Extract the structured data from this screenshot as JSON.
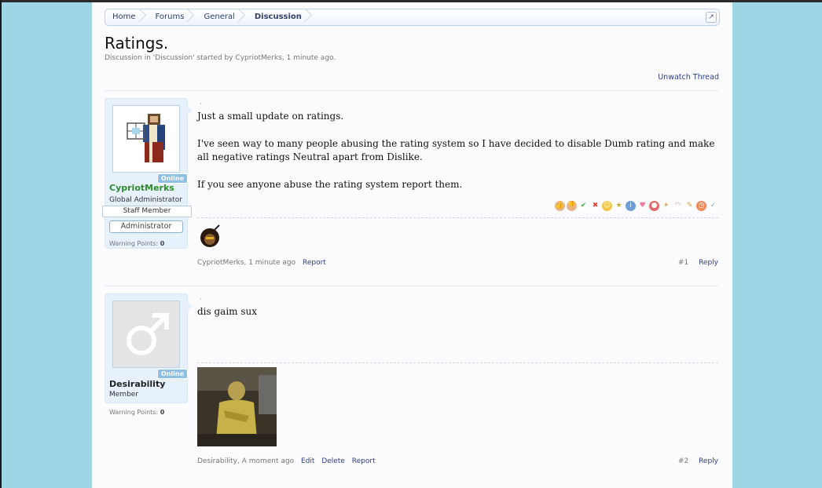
{
  "breadcrumb": {
    "items": [
      "Home",
      "Forums",
      "General",
      "Discussion"
    ],
    "jump_icon": "external-link-icon"
  },
  "thread": {
    "title": "Ratings.",
    "description": "Discussion in 'Discussion' started by CypriotMerks, 1 minute ago.",
    "unwatch_label": "Unwatch Thread"
  },
  "posts": [
    {
      "username": "CypriotMerks",
      "username_color": "#2e8b2e",
      "user_title": "Global Administrator",
      "banner": "Staff Member",
      "role_button": "Administrator",
      "online_badge": "Online",
      "warning_label": "Warning Points:",
      "warning_value": "0",
      "paragraphs": [
        "Just a small update on ratings.",
        "I've seen way to many people abusing the rating system so I have decided to disable Dumb rating and make all negative ratings Neutral apart from Dislike.",
        "If you see anyone abuse the rating system report them."
      ],
      "meta_author": "CypriotMerks",
      "meta_time": "1 minute ago",
      "actions": [
        "Report"
      ],
      "post_number": "#1",
      "reply_label": "Reply",
      "rating_icons": [
        "like-icon",
        "dislike-icon",
        "agree-icon",
        "disagree-icon",
        "funny-icon",
        "winner-icon",
        "informative-icon",
        "friendly-icon",
        "useful-icon",
        "optimistic-icon",
        "creative-icon",
        "coherent-icon",
        "late-icon",
        "programming-icon"
      ]
    },
    {
      "username": "Desirability",
      "username_color": "#222222",
      "user_title": "Member",
      "online_badge": "Online",
      "warning_label": "Warning Points:",
      "warning_value": "0",
      "paragraphs": [
        "dis gaim sux"
      ],
      "meta_author": "Desirability",
      "meta_time": "A moment ago",
      "actions": [
        "Edit",
        "Delete",
        "Report"
      ],
      "post_number": "#2",
      "reply_label": "Reply"
    }
  ],
  "colors": {
    "background": "#9ed6e6",
    "link": "#2b3f88",
    "online_badge": "#8ebfe4"
  }
}
